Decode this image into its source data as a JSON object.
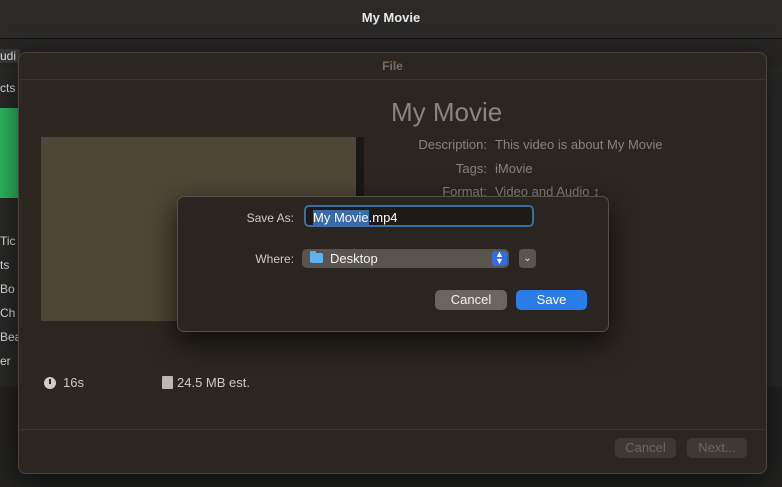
{
  "window": {
    "title": "My Movie"
  },
  "background": {
    "left_labels": [
      "udi",
      "cts",
      "Tic",
      "ts",
      "Bo",
      "Ch",
      "Bea",
      "er"
    ]
  },
  "sheet": {
    "title": "File",
    "movie_title": "My Movie",
    "fields": {
      "description_label": "Description:",
      "description_value": "This video is about My Movie",
      "tags_label": "Tags:",
      "tags_value": "iMovie",
      "format_label": "Format:",
      "format_value": "Video and Audio ↕"
    },
    "duration": "16s",
    "size_estimate": "24.5 MB est.",
    "cancel_label": "Cancel",
    "next_label": "Next..."
  },
  "save_dialog": {
    "save_as_label": "Save As:",
    "filename_selected": "My Movie",
    "filename_ext": ".mp4",
    "where_label": "Where:",
    "where_value": "Desktop",
    "cancel_label": "Cancel",
    "save_label": "Save"
  },
  "colors": {
    "accent": "#2b7ce7",
    "sheet_bg": "#2c2621",
    "selection": "#3a6ba8"
  }
}
